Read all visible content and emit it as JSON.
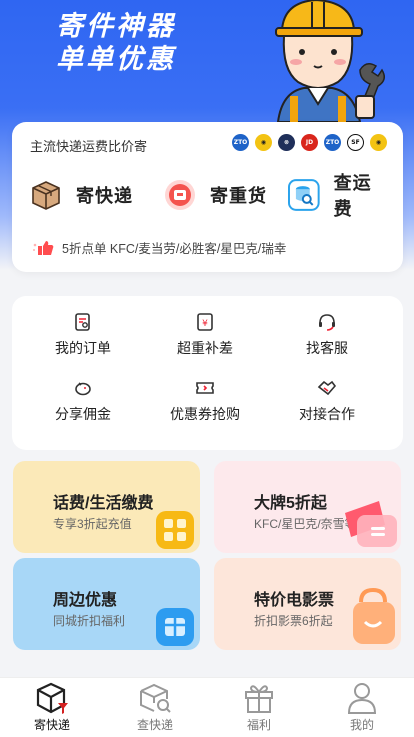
{
  "hero": {
    "title_line1": "寄件神器",
    "title_line2": "单单优惠"
  },
  "top_card": {
    "caption": "主流快递运费比价寄",
    "carriers": [
      {
        "name": "ZTO",
        "text": "ZTO",
        "color": "#1e63c8"
      },
      {
        "name": "yunda",
        "text": "",
        "color": "#f3c313"
      },
      {
        "name": "jt",
        "text": "",
        "color": "#1f2f5a"
      },
      {
        "name": "JD",
        "text": "JD",
        "color": "#d9261c"
      },
      {
        "name": "ZTO2",
        "text": "ZTO",
        "color": "#1e63c8"
      },
      {
        "name": "SF",
        "text": "SF",
        "color": "#111111"
      },
      {
        "name": "yunda2",
        "text": "",
        "color": "#f3c313"
      }
    ],
    "actions": [
      {
        "label": "寄快递",
        "icon": "package-icon"
      },
      {
        "label": "寄重货",
        "icon": "heavy-goods-icon"
      },
      {
        "label": "查运费",
        "icon": "freight-query-icon"
      }
    ],
    "promo": "5折点单 KFC/麦当劳/必胜客/星巴克/瑞幸"
  },
  "grid": [
    {
      "label": "我的订单",
      "icon": "order-icon"
    },
    {
      "label": "超重补差",
      "icon": "overweight-icon"
    },
    {
      "label": "找客服",
      "icon": "headset-icon"
    },
    {
      "label": "分享佣金",
      "icon": "piggy-bank-icon"
    },
    {
      "label": "优惠券抢购",
      "icon": "coupon-icon"
    },
    {
      "label": "对接合作",
      "icon": "handshake-icon"
    }
  ],
  "tiles": [
    {
      "title": "话费/生活缴费",
      "sub": "专享3折起充值",
      "bg": "#fbe9b8"
    },
    {
      "title": "大牌5折起",
      "sub": "KFC/星巴克/奈雪等",
      "bg": "#fde9ec"
    },
    {
      "title": "周边优惠",
      "sub": "同城折扣福利",
      "bg": "#a8d7f7"
    },
    {
      "title": "特价电影票",
      "sub": "折扣影票6折起",
      "bg": "#fde6da"
    }
  ],
  "tabs": [
    {
      "label": "寄快递",
      "active": true
    },
    {
      "label": "查快递",
      "active": false
    },
    {
      "label": "福利",
      "active": false
    },
    {
      "label": "我的",
      "active": false
    }
  ]
}
